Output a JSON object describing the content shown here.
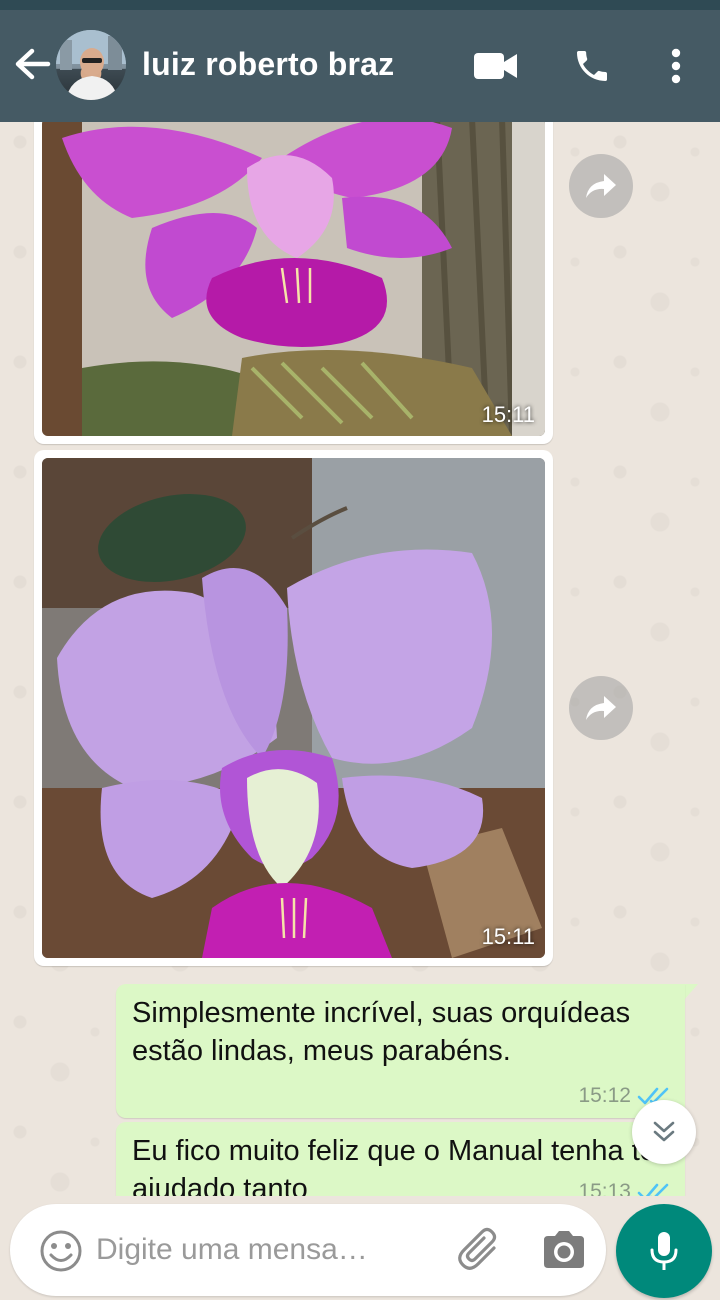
{
  "header": {
    "contact_name": "luiz roberto braz",
    "back_icon": "arrow-left-icon",
    "video_icon": "video-camera-icon",
    "call_icon": "phone-icon",
    "more_icon": "more-vertical-icon"
  },
  "messages": [
    {
      "type": "image",
      "direction": "incoming",
      "time": "15:11",
      "subject": "magenta orchid"
    },
    {
      "type": "image",
      "direction": "incoming",
      "time": "15:11",
      "subject": "lilac orchid"
    },
    {
      "type": "text",
      "direction": "outgoing",
      "text": "Simplesmente incrível, suas orquídeas estão lindas, meus parabéns.",
      "time": "15:12",
      "status": "read"
    },
    {
      "type": "text",
      "direction": "outgoing",
      "text": "Eu fico muito feliz que o Manual tenha te ajudado tanto",
      "time": "15:13",
      "status": "read"
    }
  ],
  "composer": {
    "placeholder": "Digite uma mensa…",
    "emoji_icon": "emoji-icon",
    "attach_icon": "paperclip-icon",
    "camera_icon": "camera-icon",
    "mic_icon": "microphone-icon"
  },
  "colors": {
    "app_bar": "#455a64",
    "outgoing_bubble": "#dcf8c6",
    "read_ticks": "#4fc3f7",
    "mic_button": "#00897b"
  }
}
